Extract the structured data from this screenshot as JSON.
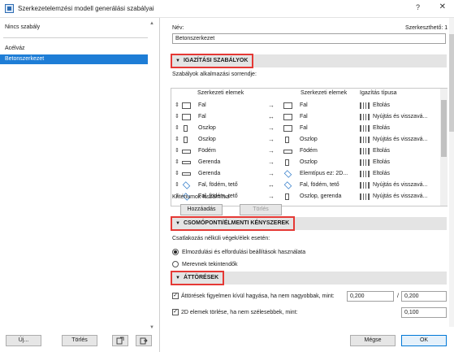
{
  "window": {
    "title": "Szerkezetelemzési modell generálási szabályai",
    "help": "?",
    "close": "✕"
  },
  "left": {
    "items": [
      "Nincs szabály",
      "Acélváz",
      "Betonszerkezet"
    ],
    "selected": 2,
    "buttons": {
      "new": "Új...",
      "delete": "Törlés"
    }
  },
  "right": {
    "name_label": "Név:",
    "editable_label": "Szerkeszthető:",
    "editable_value": "1",
    "name_value": "Betonszerkezet",
    "sections": {
      "alignment": "IGAZÍTÁSI SZABÁLYOK",
      "nodal": "CSOMÓPONTI/ÉLMENTI KÉNYSZEREK",
      "openings": "ÁTTÖRÉSEK"
    },
    "order_label": "Szabályok alkalmazási sorrendje:",
    "table": {
      "headers": [
        "Szerkezeti elemek",
        "Szerkezeti elemek",
        "Igazítás típusa"
      ],
      "rows": [
        {
          "from": "Fal",
          "to": "Fal",
          "type": "Eltolás"
        },
        {
          "from": "Fal",
          "to": "Fal",
          "type": "Nyújtás és visszavá..."
        },
        {
          "from": "Oszlop",
          "to": "Fal",
          "type": "Eltolás"
        },
        {
          "from": "Oszlop",
          "to": "Oszlop",
          "type": "Nyújtás és visszavá..."
        },
        {
          "from": "Födém",
          "to": "Födém",
          "type": "Eltolás"
        },
        {
          "from": "Gerenda",
          "to": "Oszlop",
          "type": "Eltolás"
        },
        {
          "from": "Gerenda",
          "to": "Elemtípus ez: 2D...",
          "type": "Eltolás"
        },
        {
          "from": "Fal, födém, tető",
          "to": "Fal, födém, tető",
          "type": "Nyújtás és visszavá..."
        },
        {
          "from": "Fal, födém, tető",
          "to": "Oszlop, gerenda",
          "type": "Nyújtás és visszavá..."
        }
      ]
    },
    "criteria_label": "Kritériumok kiszámítva",
    "add_button": "Hozzáadás",
    "delete_button": "Törlés",
    "nodal_text": "Csatlakozás nélküli végek/élek esetén:",
    "radio1": "Elmozdulási és elfordulási beállítások használata",
    "radio2": "Merevnek tekintendők",
    "openings_check1": "Áttörések figyelmen kívül hagyása, ha nem nagyobbak, mint:",
    "openings_val1a": "0,200",
    "openings_sep": "/",
    "openings_val1b": "0,200",
    "openings_check2": "2D elemek törlése, ha nem szélesebbek, mint:",
    "openings_val2": "0,100",
    "cancel": "Mégse",
    "ok": "OK"
  }
}
